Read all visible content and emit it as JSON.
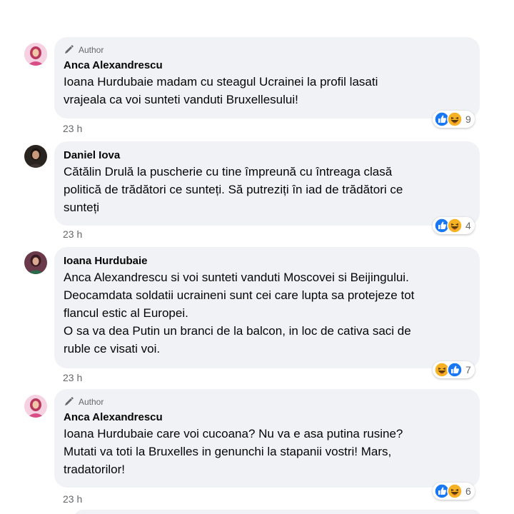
{
  "author_label": "Author",
  "comments": [
    {
      "name": "Anca Alexandrescu",
      "is_author": true,
      "text": "Ioana Hurdubaie madam cu steagul Ucrainei la profil lasati\nvrajeala ca voi sunteti vanduti Bruxellesului!",
      "time": "23 h",
      "reaction_count": "9",
      "reactions": [
        "like-icon",
        "haha-icon"
      ]
    },
    {
      "name": "Daniel Iova",
      "is_author": false,
      "text": "Cătălin Drulă la puscherie cu tine împreună cu întreaga clasă\npolitică de trădători ce sunteți. Să putreziți în iad de trădători ce\nsunteți",
      "time": "23 h",
      "reaction_count": "4",
      "reactions": [
        "like-icon",
        "haha-icon"
      ]
    },
    {
      "name": "Ioana Hurdubaie",
      "is_author": false,
      "text": "Anca Alexandrescu si voi sunteti vanduti Moscovei si Beijingului.\nDeocamdata soldatii ucraineni sunt cei care lupta sa protejeze tot\nflancul estic al Europei.\nO sa va dea Putin un branci de la balcon, in loc de cativa saci de\nruble ce visati voi.",
      "time": "23 h",
      "reaction_count": "7",
      "reactions": [
        "haha-icon",
        "like-icon"
      ]
    },
    {
      "name": "Anca Alexandrescu",
      "is_author": true,
      "text": "Ioana Hurdubaie care voi cucoana? Nu va e asa putina rusine?\nMutati va toti la Bruxelles in genunchi la stapanii vostri! Mars,\ntradatorilor!",
      "time": "23 h",
      "reaction_count": "6",
      "reactions": [
        "like-icon",
        "haha-icon"
      ]
    }
  ],
  "colors": {
    "bubble": "#f0f2f5",
    "secondary_text": "#65676b",
    "like": "#1877f2",
    "haha": "#f7b125"
  }
}
